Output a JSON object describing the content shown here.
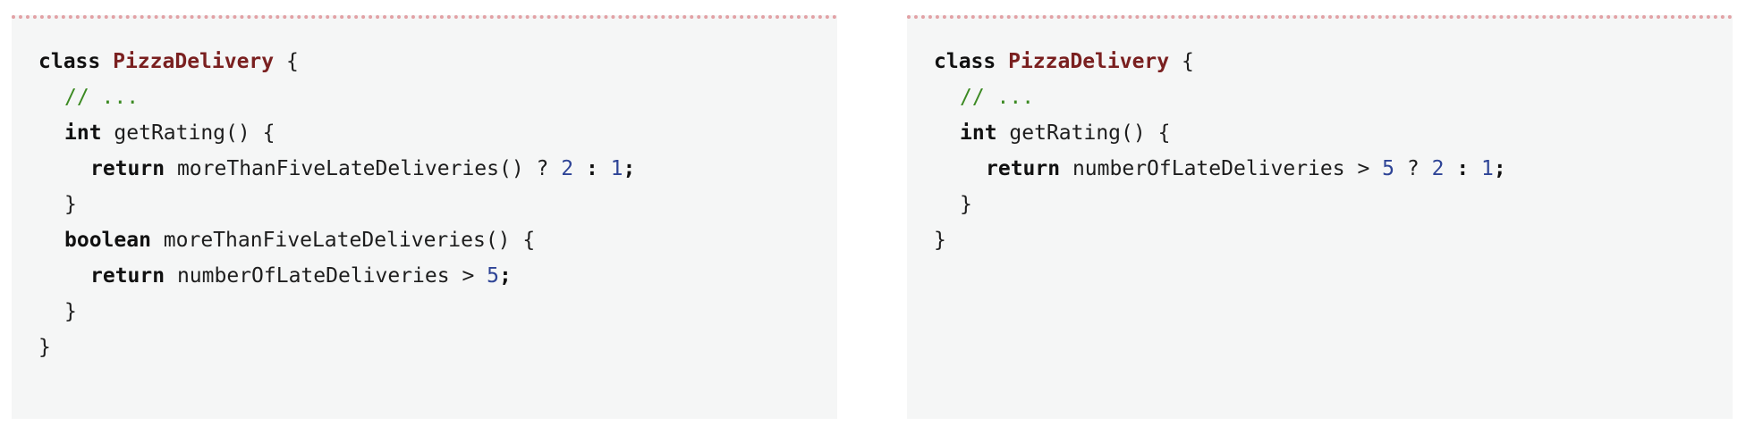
{
  "left": {
    "l1": {
      "kw": "class",
      "cls": "PizzaDelivery",
      "brace": "{"
    },
    "l2": {
      "comment": "// ..."
    },
    "l3": {
      "kw": "int",
      "rest": "getRating() {"
    },
    "l4": {
      "kw": "return",
      "call": "moreThanFiveLateDeliveries() ?",
      "n1": "2",
      "colon": ":",
      "n2": "1",
      "semi": ";"
    },
    "l5": {
      "brace": "}"
    },
    "l6": {
      "kw": "boolean",
      "rest": "moreThanFiveLateDeliveries() {"
    },
    "l7": {
      "kw": "return",
      "expr": "numberOfLateDeliveries >",
      "n": "5",
      "semi": ";"
    },
    "l8": {
      "brace": "}"
    },
    "l9": {
      "brace": "}"
    }
  },
  "right": {
    "l1": {
      "kw": "class",
      "cls": "PizzaDelivery",
      "brace": "{"
    },
    "l2": {
      "comment": "// ..."
    },
    "l3": {
      "kw": "int",
      "rest": "getRating() {"
    },
    "l4": {
      "kw": "return",
      "expr": "numberOfLateDeliveries >",
      "n0": "5",
      "q": "?",
      "n1": "2",
      "colon": ":",
      "n2": "1",
      "semi": ";"
    },
    "l5": {
      "brace": "}"
    },
    "l6": {
      "brace": "}"
    }
  }
}
